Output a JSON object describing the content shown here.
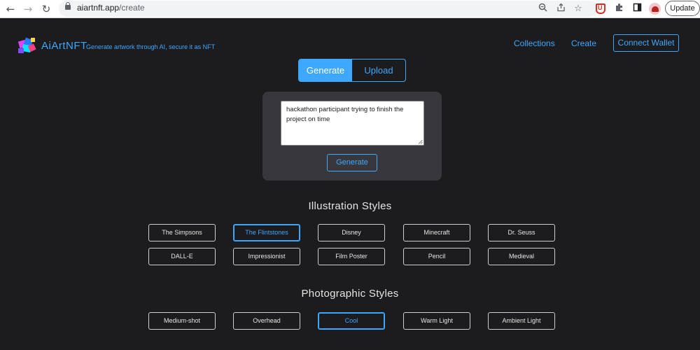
{
  "browser": {
    "url_host": "aiartnft.app",
    "url_path": "/create",
    "update_label": "Update"
  },
  "header": {
    "brand": "AiArtNFT",
    "tagline": "Generate artwork through AI, secure it as NFT",
    "nav": [
      "Collections",
      "Create"
    ],
    "connect_label": "Connect Wallet"
  },
  "tabs": [
    {
      "label": "Generate",
      "active": true
    },
    {
      "label": "Upload",
      "active": false
    }
  ],
  "prompt": {
    "value": "hackathon participant trying to finish the project on time",
    "button_label": "Generate"
  },
  "illustration": {
    "title": "Illustration Styles",
    "items": [
      {
        "label": "The Simpsons",
        "selected": false
      },
      {
        "label": "The Flintstones",
        "selected": true
      },
      {
        "label": "Disney",
        "selected": false
      },
      {
        "label": "Minecraft",
        "selected": false
      },
      {
        "label": "Dr. Seuss",
        "selected": false
      },
      {
        "label": "DALL-E",
        "selected": false
      },
      {
        "label": "Impressionist",
        "selected": false
      },
      {
        "label": "Film Poster",
        "selected": false
      },
      {
        "label": "Pencil",
        "selected": false
      },
      {
        "label": "Medieval",
        "selected": false
      }
    ]
  },
  "photographic": {
    "title": "Photographic Styles",
    "items": [
      {
        "label": "Medium-shot",
        "selected": false
      },
      {
        "label": "Overhead",
        "selected": false
      },
      {
        "label": "Cool",
        "selected": true
      },
      {
        "label": "Warm Light",
        "selected": false
      },
      {
        "label": "Ambient Light",
        "selected": false
      }
    ]
  },
  "colors": {
    "accent": "#3ea8ff",
    "background": "#1c1c1e",
    "card": "#38383c"
  }
}
